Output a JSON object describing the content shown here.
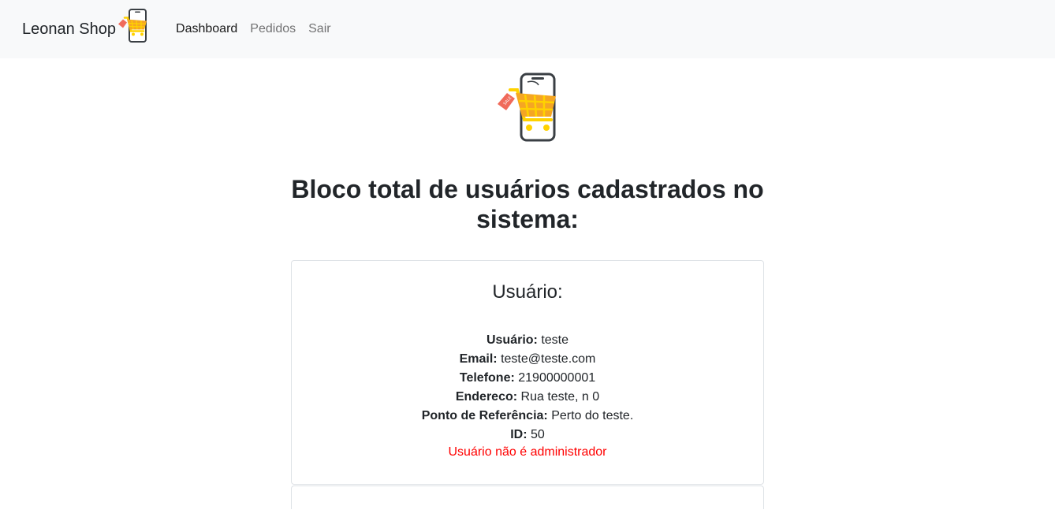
{
  "navbar": {
    "brand": "Leonan Shop",
    "links": [
      {
        "label": "Dashboard",
        "active": true
      },
      {
        "label": "Pedidos",
        "active": false
      },
      {
        "label": "Sair",
        "active": false
      }
    ]
  },
  "page": {
    "title": "Bloco total de usuários cadastrados no sistema:"
  },
  "user_card": {
    "heading": "Usuário:",
    "fields": [
      {
        "label": "Usuário:",
        "value": "teste"
      },
      {
        "label": "Email:",
        "value": "teste@teste.com"
      },
      {
        "label": "Telefone:",
        "value": "21900000001"
      },
      {
        "label": "Endereco:",
        "value": "Rua teste, n 0"
      },
      {
        "label": "Ponto de Referência:",
        "value": "Perto do teste."
      },
      {
        "label": "ID:",
        "value": "50"
      }
    ],
    "admin_status": "Usuário não é administrador"
  },
  "icons": {
    "logo": "phone-shopping-cart-icon",
    "sale_tag": "SALE"
  },
  "colors": {
    "navbar_bg": "#f8f9fa",
    "status_red": "#ff0000",
    "cart_orange": "#f5a623",
    "cart_yellow": "#ffd200",
    "tag_red": "#f06a5a"
  }
}
